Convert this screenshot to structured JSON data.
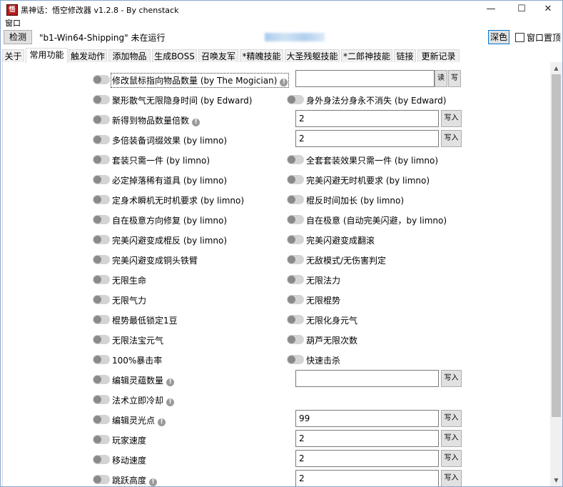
{
  "window": {
    "title": "黑神话：悟空修改器 v1.2.8 - By chenstack",
    "icon": "app-icon",
    "controls": [
      "minimize-icon",
      "maximize-icon",
      "close-icon"
    ]
  },
  "menu": {
    "window_label": "窗口"
  },
  "toolbar": {
    "detect_label": "检测",
    "status_text": "\"b1-Win64-Shipping\" 未在运行",
    "dark_label": "深色",
    "topmost_label": "窗口置顶"
  },
  "tabs": [
    "关于",
    "常用功能",
    "触发动作",
    "添加物品",
    "生成BOSS",
    "召唤友军",
    "*精魄技能",
    "大圣残躯技能",
    "*二郎神技能",
    "链接",
    "更新记录"
  ],
  "active_tab": "常用功能",
  "features": {
    "r0": {
      "label": "修改鼠标指向物品数量 (by The Mogician)",
      "value": "",
      "read_btn": "读",
      "write_btn": "写"
    },
    "r1": {
      "left": "聚形散气无限隐身时间 (by Edward)",
      "right": "身外身法分身永不消失 (by Edward)"
    },
    "r2": {
      "label": "新得到物品数量倍数",
      "value": "2",
      "write_btn": "写入"
    },
    "r3": {
      "label": "多倍装备词缀效果 (by limno)",
      "value": "2",
      "write_btn": "写入"
    },
    "r4": {
      "left": "套装只需一件 (by limno)",
      "right": "全套套装效果只需一件 (by limno)"
    },
    "r5": {
      "left": "必定掉落稀有道具 (by limno)",
      "right": "完美闪避无时机要求 (by limno)"
    },
    "r6": {
      "left": "定身术瞬机无时机要求 (by limno)",
      "right": "棍反时间加长 (by limno)"
    },
    "r7": {
      "left": "自在极意方向修复 (by limno)",
      "right": "自在极意 (自动完美闪避，by limno)"
    },
    "r8": {
      "left": "完美闪避变成棍反 (by limno)",
      "right": "完美闪避变成翻滚"
    },
    "r9": {
      "left": "完美闪避变成铜头铁臂",
      "right": "无敌模式/无伤害判定"
    },
    "r10": {
      "left": "无限生命",
      "right": "无限法力"
    },
    "r11": {
      "left": "无限气力",
      "right": "无限棍势"
    },
    "r12": {
      "left": "棍势最低锁定1豆",
      "right": "无限化身元气"
    },
    "r13": {
      "left": "无限法宝元气",
      "right": "葫芦无限次数"
    },
    "r14": {
      "left": "100%暴击率",
      "right": "快速击杀"
    },
    "r15": {
      "label": "编辑灵蕴数量",
      "value": "",
      "write_btn": "写入"
    },
    "r16": {
      "label": "法术立即冷却"
    },
    "r17": {
      "label": "编辑灵光点",
      "value": "99",
      "write_btn": "写入"
    },
    "r18": {
      "label": "玩家速度",
      "value": "2",
      "write_btn": "写入"
    },
    "r19": {
      "label": "移动速度",
      "value": "2",
      "write_btn": "写入"
    },
    "r20": {
      "label": "跳跃高度",
      "value": "2",
      "write_btn": "写入"
    }
  },
  "info_glyph": "!",
  "scrollbar": {
    "up": "▲",
    "down": "▼"
  },
  "colors": {
    "accent": "#0078d7",
    "toggle_off": "#d4d4d4",
    "knob": "#8a8a8a"
  }
}
